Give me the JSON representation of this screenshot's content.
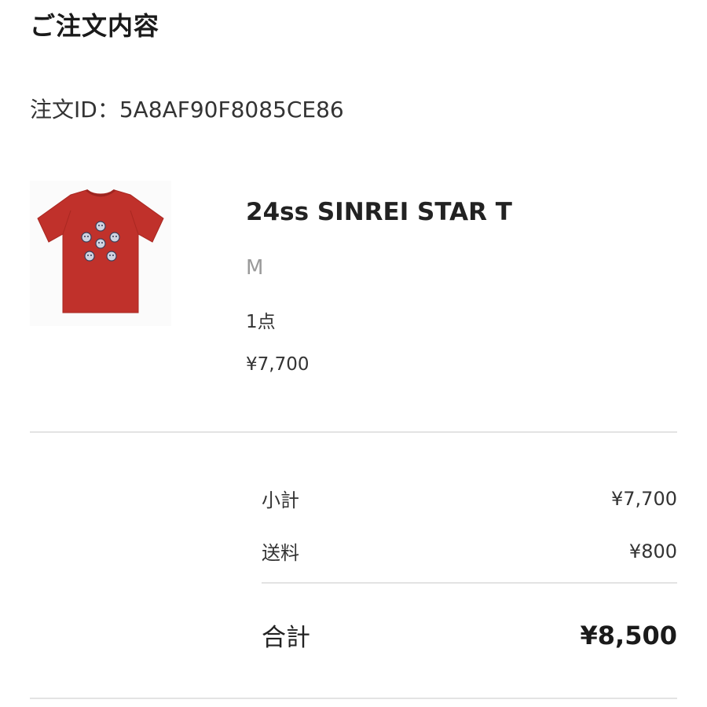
{
  "header": {
    "title": "ご注文内容"
  },
  "order": {
    "id_label": "注文ID：5A8AF90F8085CE86"
  },
  "product": {
    "image_icon": "red-tshirt-image",
    "name": "24ss SINREI STAR T",
    "size": "M",
    "quantity": "1点",
    "price": "¥7,700"
  },
  "summary": {
    "subtotal_label": "小計",
    "subtotal_value": "¥7,700",
    "shipping_label": "送料",
    "shipping_value": "¥800",
    "total_label": "合計",
    "total_value": "¥8,500"
  },
  "colors": {
    "shirt": "#c0312b",
    "text": "#222222",
    "muted": "#9a9a9a",
    "divider": "#e3e3e3"
  }
}
